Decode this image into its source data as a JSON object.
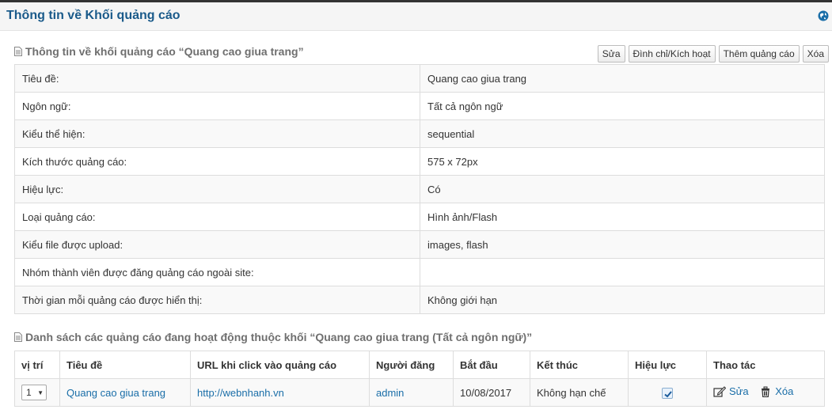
{
  "header": {
    "title": "Thông tin về Khối quảng cáo",
    "help_icon": "globe-help-icon"
  },
  "info_section": {
    "title": "Thông tin về khối quảng cáo “Quang cao giua trang”",
    "actions": {
      "edit": "Sửa",
      "toggle": "Đình chỉ/Kích hoạt",
      "add_ad": "Thêm quảng cáo",
      "delete": "Xóa"
    },
    "rows": [
      {
        "label": "Tiêu đề:",
        "value": "Quang cao giua trang"
      },
      {
        "label": "Ngôn ngữ:",
        "value": "Tất cả ngôn ngữ"
      },
      {
        "label": "Kiểu thể hiện:",
        "value": "sequential"
      },
      {
        "label": "Kích thước quảng cáo:",
        "value": "575 x 72px"
      },
      {
        "label": "Hiệu lực:",
        "value": "Có"
      },
      {
        "label": "Loại quảng cáo:",
        "value": "Hình ảnh/Flash"
      },
      {
        "label": "Kiểu file được upload:",
        "value": "images, flash"
      },
      {
        "label": "Nhóm thành viên được đăng quảng cáo ngoài site:",
        "value": ""
      },
      {
        "label": "Thời gian mỗi quảng cáo được hiển thị:",
        "value": "Không giới hạn"
      }
    ]
  },
  "list_section": {
    "title": "Danh sách các quảng cáo đang hoạt động thuộc khối “Quang cao giua trang (Tất cả ngôn ngữ)”",
    "columns": {
      "position": "vị trí",
      "title": "Tiêu đề",
      "url": "URL khi click vào quảng cáo",
      "poster": "Người đăng",
      "start": "Bắt đầu",
      "end": "Kết thúc",
      "active": "Hiệu lực",
      "actions": "Thao tác"
    },
    "rows": [
      {
        "position": "1",
        "title": "Quang cao giua trang",
        "url": "http://webnhanh.vn",
        "poster": "admin",
        "start": "10/08/2017",
        "end": "Không hạn chế",
        "active": true,
        "edit_label": "Sửa",
        "delete_label": "Xóa"
      }
    ]
  },
  "colors": {
    "header_title": "#1a5a8a",
    "link": "#1a6ea8",
    "section_title": "#6f6f6f"
  }
}
